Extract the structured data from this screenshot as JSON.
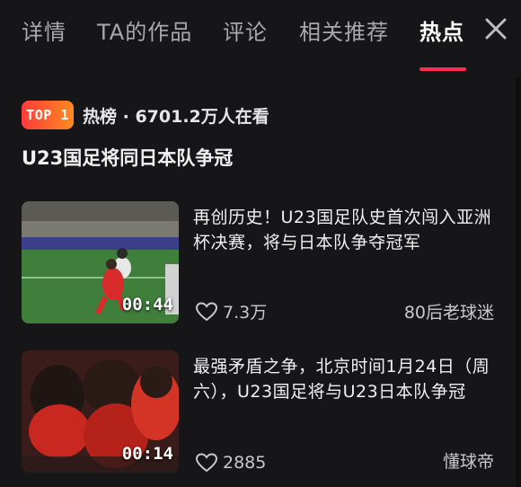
{
  "tabs": [
    {
      "label": "详情"
    },
    {
      "label": "TA的作品"
    },
    {
      "label": "评论"
    },
    {
      "label": "相关推荐"
    },
    {
      "label": "热点",
      "active": true
    }
  ],
  "hot": {
    "badge": "TOP 1",
    "text": "热榜 · 6701.2万人在看",
    "headline": "U23国足将同日本队争冠"
  },
  "videos": [
    {
      "title": "再创历史！U23国足队史首次闯入亚洲杯决赛，将与日本队争夺冠军",
      "duration": "00:44",
      "likes": "7.3万",
      "author": "80后老球迷",
      "thumb_icon": "soccer-match-icon"
    },
    {
      "title": "最强矛盾之争，北京时间1月24日（周六），U23国足将与U23日本队争冠",
      "duration": "00:14",
      "likes": "2885",
      "author": "懂球帝",
      "thumb_icon": "players-crowd-icon"
    }
  ],
  "colors": {
    "accent": "#fe2c55",
    "background": "#161618",
    "badge_from": "#ff3b3b",
    "badge_to": "#ff8a1f"
  }
}
